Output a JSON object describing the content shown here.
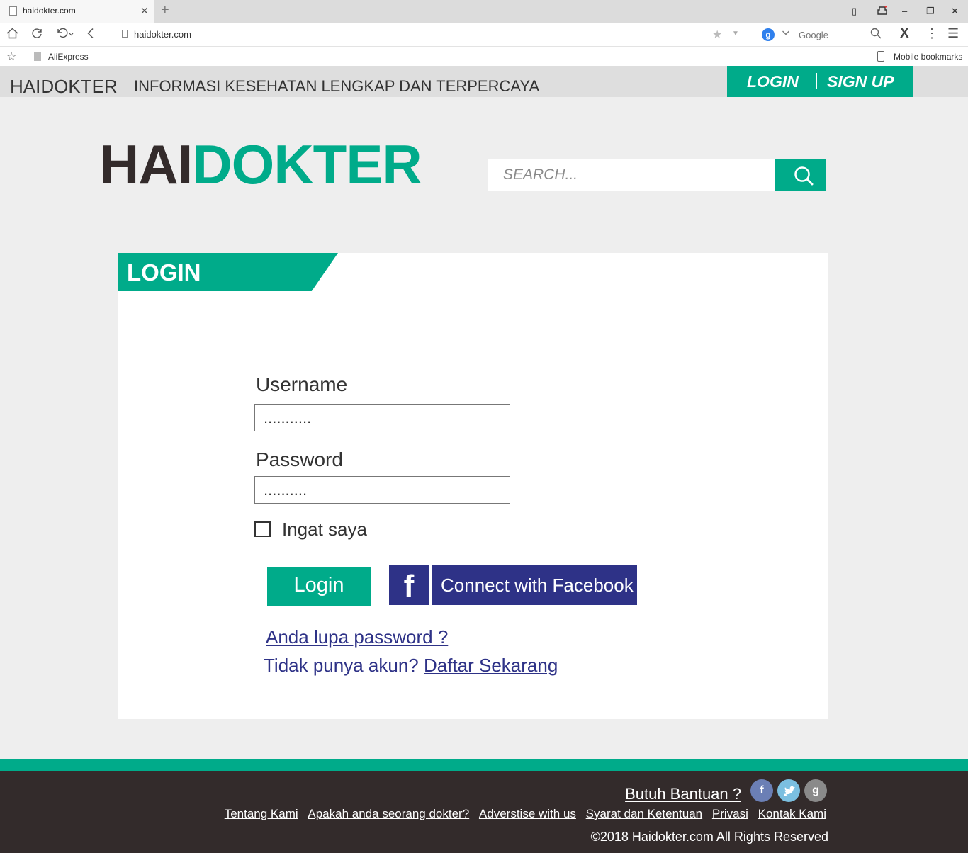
{
  "browser": {
    "tab_title": "haidokter.com",
    "tab_close": "✕",
    "new_tab": "+",
    "url": "haidokter.com",
    "search_engine_name": "Google",
    "search_engine_letter": "g",
    "bookmark_label": "AliExpress",
    "mobile_bookmarks_label": "Mobile bookmarks",
    "window_controls": [
      "▯",
      "‒",
      "❐",
      "✕"
    ]
  },
  "site_bar": {
    "brand": "HAIDOKTER",
    "tagline": "INFORMASI KESEHATAN LENGKAP DAN TERPERCAYA",
    "login_label": "LOGIN",
    "signup_label": "SIGN UP"
  },
  "logo": {
    "part1": "HAI",
    "part2": "DOKTER"
  },
  "search": {
    "placeholder": "SEARCH..."
  },
  "login_panel": {
    "title": "LOGIN",
    "username_label": "Username",
    "username_value": "...........",
    "password_label": "Password",
    "password_value": "..........",
    "remember_label": "Ingat saya",
    "login_button": "Login",
    "facebook_icon_letter": "f",
    "facebook_button": "Connect with Facebook",
    "forgot_link": "Anda lupa password ?",
    "no_account_text": "Tidak punya akun?",
    "register_link": "Daftar Sekarang"
  },
  "footer": {
    "help_link": "Butuh Bantuan ?",
    "social": [
      "f",
      "t",
      "g"
    ],
    "links": [
      "Tentang Kami",
      "Apakah anda seorang dokter?",
      "Adverstise with us",
      "Syarat dan Ketentuan",
      "Privasi",
      "Kontak Kami"
    ],
    "copyright": "©2018 Haidokter.com All Rights Reserved"
  },
  "colors": {
    "brand_green": "#00ab8a",
    "dark": "#332b2b",
    "facebook_blue": "#2e3287"
  }
}
